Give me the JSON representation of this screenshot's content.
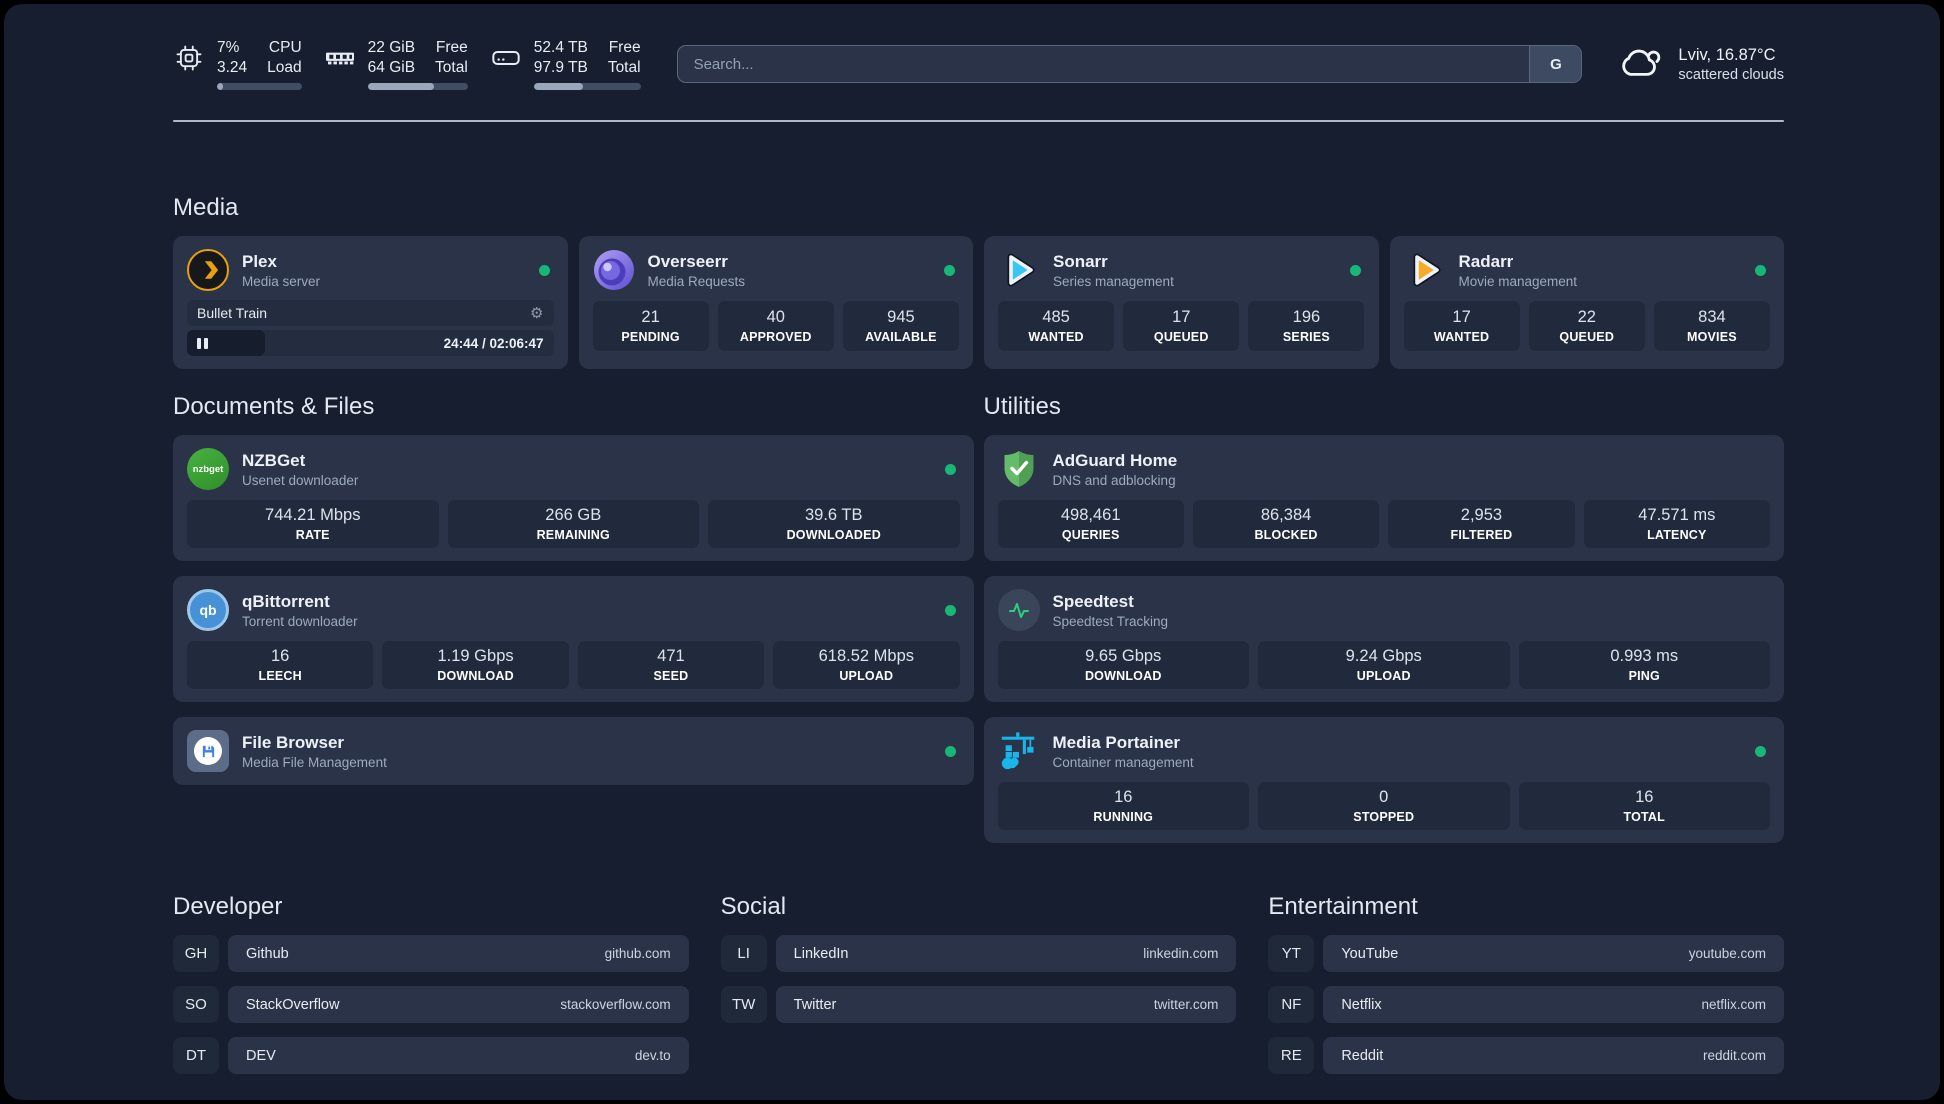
{
  "topbar": {
    "resources": [
      {
        "icon": "cpu-icon",
        "values": [
          "7%",
          "3.24"
        ],
        "labels": [
          "CPU",
          "Load"
        ],
        "progress_pct": 7
      },
      {
        "icon": "memory-icon",
        "values": [
          "22 GiB",
          "64 GiB"
        ],
        "labels": [
          "Free",
          "Total"
        ],
        "progress_pct": 66
      },
      {
        "icon": "disk-icon",
        "values": [
          "52.4 TB",
          "97.9 TB"
        ],
        "labels": [
          "Free",
          "Total"
        ],
        "progress_pct": 46
      }
    ],
    "search": {
      "placeholder": "Search...",
      "engine_button": "G"
    },
    "weather": {
      "icon": "cloud-icon",
      "line1": "Lviv, 16.87°C",
      "line2": "scattered clouds"
    }
  },
  "colors": {
    "page_bg": "#161e2f",
    "card_bg": "#2a3347",
    "stat_bg": "#212a3c",
    "status_online": "#17b877"
  },
  "sections": {
    "media": {
      "title": "Media",
      "cards": [
        {
          "icon": "plex-icon",
          "name": "Plex",
          "subtitle": "Media server",
          "status": "online",
          "player": {
            "title": "Bullet Train",
            "time": "24:44 / 02:06:47"
          }
        },
        {
          "icon": "overseerr-icon",
          "name": "Overseerr",
          "subtitle": "Media Requests",
          "status": "online",
          "stats": [
            {
              "value": "21",
              "label": "PENDING"
            },
            {
              "value": "40",
              "label": "APPROVED"
            },
            {
              "value": "945",
              "label": "AVAILABLE"
            }
          ]
        },
        {
          "icon": "sonarr-icon",
          "name": "Sonarr",
          "subtitle": "Series management",
          "status": "online",
          "stats": [
            {
              "value": "485",
              "label": "WANTED"
            },
            {
              "value": "17",
              "label": "QUEUED"
            },
            {
              "value": "196",
              "label": "SERIES"
            }
          ]
        },
        {
          "icon": "radarr-icon",
          "name": "Radarr",
          "subtitle": "Movie management",
          "status": "online",
          "stats": [
            {
              "value": "17",
              "label": "WANTED"
            },
            {
              "value": "22",
              "label": "QUEUED"
            },
            {
              "value": "834",
              "label": "MOVIES"
            }
          ]
        }
      ]
    },
    "documents": {
      "title": "Documents & Files",
      "cards": [
        {
          "icon": "nzbget-icon",
          "icon_text": "nzbget",
          "name": "NZBGet",
          "subtitle": "Usenet downloader",
          "status": "online",
          "stats": [
            {
              "value": "744.21 Mbps",
              "label": "RATE"
            },
            {
              "value": "266 GB",
              "label": "REMAINING"
            },
            {
              "value": "39.6 TB",
              "label": "DOWNLOADED"
            }
          ]
        },
        {
          "icon": "qbittorrent-icon",
          "icon_text": "qb",
          "name": "qBittorrent",
          "subtitle": "Torrent downloader",
          "status": "online",
          "stats": [
            {
              "value": "16",
              "label": "LEECH"
            },
            {
              "value": "1.19 Gbps",
              "label": "DOWNLOAD"
            },
            {
              "value": "471",
              "label": "SEED"
            },
            {
              "value": "618.52 Mbps",
              "label": "UPLOAD"
            }
          ]
        },
        {
          "icon": "filebrowser-icon",
          "name": "File Browser",
          "subtitle": "Media File Management",
          "status": "online"
        }
      ]
    },
    "utilities": {
      "title": "Utilities",
      "cards": [
        {
          "icon": "adguard-icon",
          "name": "AdGuard Home",
          "subtitle": "DNS and adblocking",
          "stats": [
            {
              "value": "498,461",
              "label": "QUERIES"
            },
            {
              "value": "86,384",
              "label": "BLOCKED"
            },
            {
              "value": "2,953",
              "label": "FILTERED"
            },
            {
              "value": "47.571 ms",
              "label": "LATENCY"
            }
          ]
        },
        {
          "icon": "speedtest-icon",
          "name": "Speedtest",
          "subtitle": "Speedtest Tracking",
          "stats": [
            {
              "value": "9.65 Gbps",
              "label": "DOWNLOAD"
            },
            {
              "value": "9.24 Gbps",
              "label": "UPLOAD"
            },
            {
              "value": "0.993 ms",
              "label": "PING"
            }
          ]
        },
        {
          "icon": "portainer-icon",
          "name": "Media Portainer",
          "subtitle": "Container management",
          "status": "online",
          "stats": [
            {
              "value": "16",
              "label": "RUNNING"
            },
            {
              "value": "0",
              "label": "STOPPED"
            },
            {
              "value": "16",
              "label": "TOTAL"
            }
          ]
        }
      ]
    },
    "bookmarks": [
      {
        "title": "Developer",
        "items": [
          {
            "abbr": "GH",
            "name": "Github",
            "url": "github.com"
          },
          {
            "abbr": "SO",
            "name": "StackOverflow",
            "url": "stackoverflow.com"
          },
          {
            "abbr": "DT",
            "name": "DEV",
            "url": "dev.to"
          }
        ]
      },
      {
        "title": "Social",
        "items": [
          {
            "abbr": "LI",
            "name": "LinkedIn",
            "url": "linkedin.com"
          },
          {
            "abbr": "TW",
            "name": "Twitter",
            "url": "twitter.com"
          }
        ]
      },
      {
        "title": "Entertainment",
        "items": [
          {
            "abbr": "YT",
            "name": "YouTube",
            "url": "youtube.com"
          },
          {
            "abbr": "NF",
            "name": "Netflix",
            "url": "netflix.com"
          },
          {
            "abbr": "RE",
            "name": "Reddit",
            "url": "reddit.com"
          }
        ]
      }
    ]
  }
}
